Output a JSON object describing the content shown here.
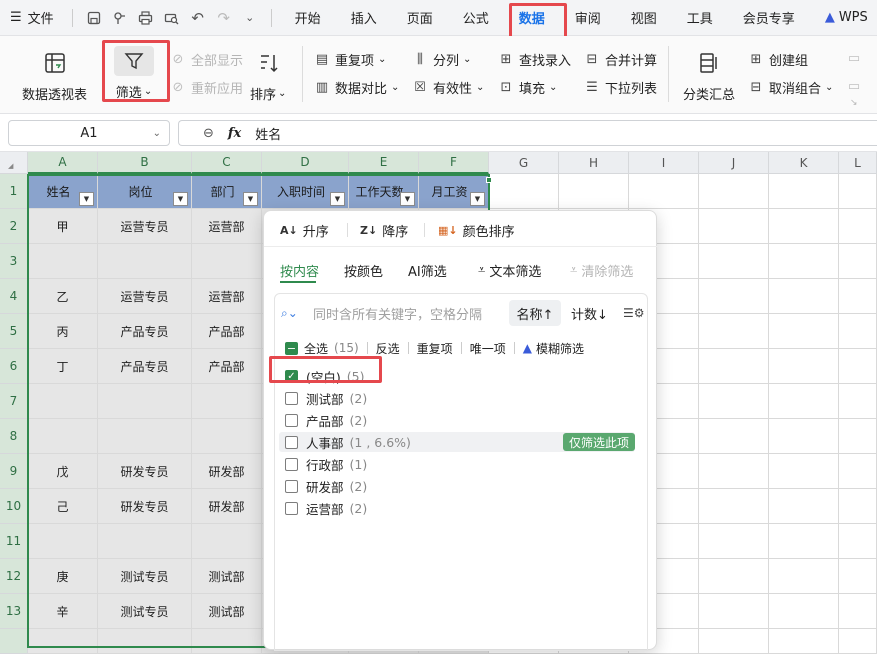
{
  "menubar": {
    "menu_label": "文件",
    "tabs": [
      "开始",
      "插入",
      "页面",
      "公式",
      "数据",
      "审阅",
      "视图",
      "工具",
      "会员专享",
      "WPS"
    ],
    "active_tab": "数据"
  },
  "ribbon": {
    "pivot": "数据透视表",
    "filter": "筛选",
    "show_all": "全部显示",
    "reapply": "重新应用",
    "sort": "排序",
    "duplicates": "重复项",
    "compare": "数据对比",
    "split": "分列",
    "validity": "有效性",
    "lookup": "查找录入",
    "fill": "填充",
    "merge_calc": "合并计算",
    "dropdown_list": "下拉列表",
    "subtotal": "分类汇总",
    "create_group": "创建组",
    "ungroup": "取消组合"
  },
  "formula": {
    "cell_ref": "A1",
    "fx": "fx",
    "value": "姓名"
  },
  "grid": {
    "columns": [
      "A",
      "B",
      "C",
      "D",
      "E",
      "F",
      "G",
      "H",
      "I",
      "J",
      "K",
      "L"
    ],
    "rows": [
      "1",
      "2",
      "3",
      "4",
      "5",
      "6",
      "7",
      "8",
      "9",
      "10",
      "11",
      "12",
      "13",
      ""
    ],
    "header_row": [
      "姓名",
      "岗位",
      "部门",
      "入职时间",
      "工作天数",
      "月工资"
    ],
    "data": [
      [
        "甲",
        "运营专员",
        "运营部"
      ],
      [
        "",
        "",
        ""
      ],
      [
        "乙",
        "运营专员",
        "运营部"
      ],
      [
        "丙",
        "产品专员",
        "产品部"
      ],
      [
        "丁",
        "产品专员",
        "产品部"
      ],
      [
        "",
        "",
        ""
      ],
      [
        "",
        "",
        ""
      ],
      [
        "戊",
        "研发专员",
        "研发部"
      ],
      [
        "己",
        "研发专员",
        "研发部"
      ],
      [
        "",
        "",
        ""
      ],
      [
        "庚",
        "测试专员",
        "测试部"
      ],
      [
        "辛",
        "测试专员",
        "测试部"
      ],
      [
        "",
        "",
        ""
      ]
    ]
  },
  "filter_popup": {
    "sort_asc": "升序",
    "sort_desc": "降序",
    "sort_color": "颜色排序",
    "tab_content": "按内容",
    "tab_color": "按颜色",
    "tab_ai": "AI筛选",
    "text_filter": "文本筛选",
    "clear_filter": "清除筛选",
    "search_placeholder": "同时含所有关键字，空格分隔",
    "sort_name": "名称↑",
    "sort_count": "计数↓",
    "select_all": "全选",
    "select_all_count": "(15)",
    "invert": "反选",
    "dup": "重复项",
    "unique": "唯一项",
    "fuzzy": "模糊筛选",
    "options": [
      {
        "label": "(空白)",
        "count": "(5)",
        "checked": true
      },
      {
        "label": "测试部",
        "count": "(2)",
        "checked": false
      },
      {
        "label": "产品部",
        "count": "(2)",
        "checked": false
      },
      {
        "label": "人事部",
        "count": "(1 , 6.6%)",
        "checked": false,
        "hover": true
      },
      {
        "label": "行政部",
        "count": "(1)",
        "checked": false
      },
      {
        "label": "研发部",
        "count": "(2)",
        "checked": false
      },
      {
        "label": "运营部",
        "count": "(2)",
        "checked": false
      }
    ],
    "only_this": "仅筛选此项"
  },
  "colors": {
    "accent_green": "#2f8a4d",
    "highlight_red": "#e5484d",
    "header_blue": "#8aa3cc"
  }
}
